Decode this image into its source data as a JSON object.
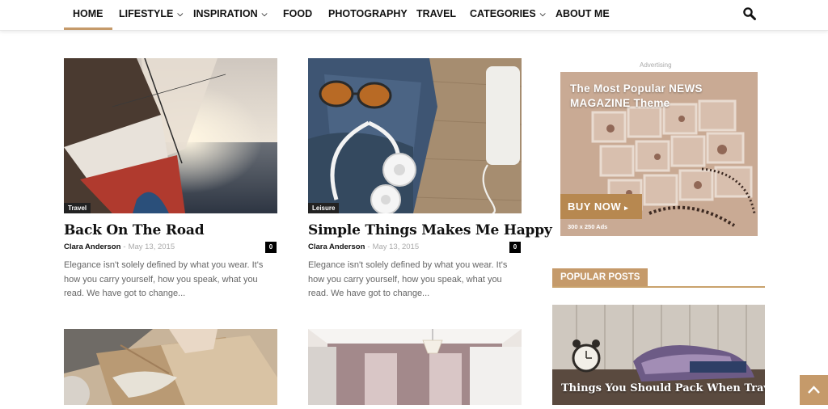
{
  "nav": {
    "items": [
      {
        "label": "HOME",
        "has_dropdown": false,
        "active": true
      },
      {
        "label": "LIFESTYLE",
        "has_dropdown": true
      },
      {
        "label": "INSPIRATION",
        "has_dropdown": true
      },
      {
        "label": "FOOD",
        "has_dropdown": false
      },
      {
        "label": "PHOTOGRAPHY",
        "has_dropdown": false
      },
      {
        "label": "TRAVEL",
        "has_dropdown": false
      },
      {
        "label": "CATEGORIES",
        "has_dropdown": true
      },
      {
        "label": "ABOUT ME",
        "has_dropdown": false
      }
    ],
    "search_icon": "search-icon",
    "accent": "#c59a6a"
  },
  "posts": [
    {
      "category": "Travel",
      "title": "Back On The Road",
      "author": "Clara Anderson",
      "separator": "-",
      "date": "May 13, 2015",
      "comments": "0",
      "excerpt": "Elegance isn't solely defined by what you wear. It's how you carry yourself, how you speak, what you read. We have got to change..."
    },
    {
      "category": "Leisure",
      "title": "Simple Things Makes Me Happy",
      "author": "Clara Anderson",
      "separator": "-",
      "date": "May 13, 2015",
      "comments": "0",
      "excerpt": "Elegance isn't solely defined by what you wear. It's how you carry yourself, how you speak, what you read. We have got to change..."
    }
  ],
  "ad": {
    "label": "Advertising",
    "headline_line1": "The Most Popular NEWS",
    "headline_line2": "MAGAZINE Theme",
    "button": "BUY NOW",
    "size_note": "300 x 250 Ads"
  },
  "popular": {
    "heading": "POPULAR POSTS",
    "first_title": "Things You Should Pack When Travel"
  },
  "back_to_top_icon": "chevron-up-icon"
}
